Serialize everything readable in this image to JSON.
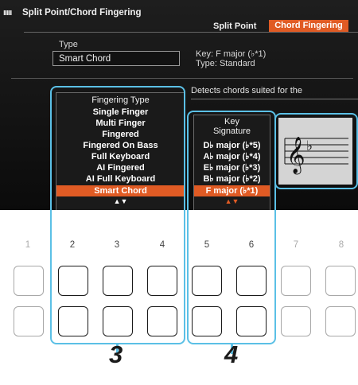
{
  "header": {
    "keyboard_icon": "keyboard-icon",
    "title": "Split Point/Chord Fingering",
    "tabs": [
      {
        "label": "Split Point",
        "active": false
      },
      {
        "label": "Chord Fingering",
        "active": true
      }
    ]
  },
  "type_section": {
    "label": "Type",
    "value": "Smart Chord",
    "key_info": "Key: F major (♭*1)",
    "type_info": "Type: Standard"
  },
  "description": "Detects chords suited for the",
  "fingering_type_list": {
    "header": "Fingering Type",
    "items": [
      "Single Finger",
      "Multi Finger",
      "Fingered",
      "Fingered On Bass",
      "Full Keyboard",
      "AI Fingered",
      "AI Full Keyboard",
      "Smart Chord"
    ],
    "selected": "Smart Chord",
    "arrows": "▲▼"
  },
  "key_signature_list": {
    "header_line1": "Key",
    "header_line2": "Signature",
    "items": [
      "D♭ major (♭*5)",
      "A♭ major (♭*4)",
      "E♭ major (♭*3)",
      "B♭ major (♭*2)",
      "F major (♭*1)"
    ],
    "selected": "F major (♭*1)",
    "arrows": "▲▼"
  },
  "staff": {
    "clef": "𝄞",
    "accidental": "♭"
  },
  "buttons": {
    "numbers": [
      "1",
      "2",
      "3",
      "4",
      "5",
      "6",
      "7",
      "8"
    ]
  },
  "steps": [
    "3",
    "4"
  ],
  "colors": {
    "accent": "#e05b24",
    "callout": "#5bc0e6"
  }
}
